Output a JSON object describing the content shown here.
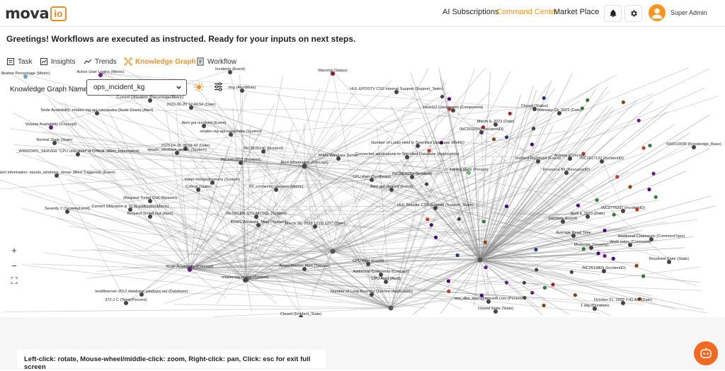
{
  "brand": {
    "logo_main": "mova",
    "logo_sub": "io"
  },
  "topnav": {
    "ai_subscriptions": "AI Subscriptions",
    "command_center": "Command Center",
    "market_place": "Market Place"
  },
  "user": {
    "name": "Super Admin"
  },
  "greeting": "Greetings! Workflows are executed as instructed. Ready for your inputs on next steps.",
  "tabs": [
    {
      "label": "Task",
      "icon": "task-icon"
    },
    {
      "label": "Insights",
      "icon": "insights-icon"
    },
    {
      "label": "Trends",
      "icon": "trends-icon"
    },
    {
      "label": "Knowledge Graph",
      "icon": "graph-icon",
      "active": true
    },
    {
      "label": "Workflow",
      "icon": "workflow-icon"
    }
  ],
  "kg": {
    "label": "Knowledge Graph Name",
    "selected": "ops_incident_kg"
  },
  "zoom": {
    "plus": "+",
    "minus": "−",
    "fit": "⛶"
  },
  "hint": "Left-click: rotate, Mouse-wheel/middle-click: zoom, Right-click: pan, Click: esc for exit full screen",
  "colors": {
    "accent": "#f39321",
    "chatbot": "#f26a21",
    "edge": "#888888"
  },
  "graph_nodes": [
    {
      "label": "ilization Percentage (Metric)",
      "color": "#5da8d8"
    },
    {
      "label": "Active User Logins (Metric)",
      "color": "#6a1b8a"
    },
    {
      "label": "Incidents (Event)",
      "color": "#444"
    },
    {
      "label": "Warning (Status)",
      "color": "#8b1a1a"
    },
    {
      "label": "Current Utilization (Percentage/Metric)",
      "color": "#444"
    },
    {
      "label": "ting (AlertMeta)",
      "color": "#444"
    },
    {
      "label": "HUL-EPOSTV CSS Internal Support (Support_Team)",
      "color": "#444"
    },
    {
      "label": "2023-06-20 12:49:54 (Date)",
      "color": "#444"
    },
    {
      "label": "Node Availability: retailer-stg-api-cassandra (Node Down) (Alert)",
      "color": "#444"
    },
    {
      "label": "Volume Availability (Concept)",
      "color": "#6a1b8a"
    },
    {
      "label": "Alert got resolved (Event)",
      "color": "#444"
    },
    {
      "label": "retailer-stg-api-cassandra (System)",
      "color": "#444"
    },
    {
      "label": "Normal State (State)",
      "color": "#444"
    },
    {
      "label": "2023-04-26 08:58:43 (Date)",
      "color": "#444"
    },
    {
      "label": "_WINDOWS_SERVER \"CPU utilization\" is Critical. (Alert_Information)",
      "color": "#444"
    },
    {
      "label": "epostv_windows_server (System)",
      "color": "#444"
    },
    {
      "label": "Alert Information: epostv_windows_server (Alert Triggered) (Event)",
      "color": "#444"
    },
    {
      "label": "INC3839140 (Incident)",
      "color": "#444"
    },
    {
      "label": "INC6461859 (Incident)",
      "color": "#444"
    },
    {
      "label": "Alert Information (Concept)",
      "color": "#444"
    },
    {
      "label": "RIMS Windows Server",
      "color": "#444"
    },
    {
      "label": "Connected applications to Specified Database (Application)",
      "color": "#444"
    },
    {
      "label": "hilun1/2 Component (Component)",
      "color": "#444"
    },
    {
      "label": "Number of Locks Held in Specified Database (Metric)",
      "color": "#444"
    },
    {
      "label": "ezlan-mongodbpmery (System)",
      "color": "#444"
    },
    {
      "label": "Critical (State)",
      "color": "#444"
    },
    {
      "label": "CPU Alert (Synthesis)",
      "color": "#444"
    },
    {
      "label": "INC2408219 (Incident)",
      "color": "#444"
    },
    {
      "label": "Alert got cleared (Event)",
      "color": "#444"
    },
    {
      "label": "Jubrick Rishi (Person)",
      "color": "#6abf69"
    },
    {
      "label": "(Request Timed Out) (Reason)",
      "color": "#444"
    },
    {
      "label": "IIS_connector_percent (Metric)",
      "color": "#444"
    },
    {
      "label": "HUL Retailer CSS Support (Support_Team)",
      "color": "#444"
    },
    {
      "label": "Current Utilization is 70 % (UtilizationMetric)",
      "color": "#444"
    },
    {
      "label": "Severity 2 (SeverityLevel)",
      "color": "#444"
    },
    {
      "label": "Request Timed Out (Alert)",
      "color": "#444"
    },
    {
      "label": "RETAILER-STG-MYSQL (System)",
      "color": "#444"
    },
    {
      "label": "IRIMS Windows_Main (System)",
      "color": "#444"
    },
    {
      "label": "March 16, 2023 12:09 UTC (Date)",
      "color": "#444"
    },
    {
      "label": "CPU Alert (Event)",
      "color": "#444"
    },
    {
      "label": "Closed (Status)",
      "color": "#444"
    },
    {
      "label": "February 19, 2023 (Date)",
      "color": "#444"
    },
    {
      "label": "INC2612550 (IncidentID)",
      "color": "#444"
    },
    {
      "label": "March 9, 2023 (Date)",
      "color": "#444"
    },
    {
      "label": "Incident Resolved (Event)",
      "color": "#444"
    },
    {
      "label": "Actions (Concept)",
      "color": "#444"
    },
    {
      "label": "INC2617132 (IncidentID)",
      "color": "#444"
    },
    {
      "label": "K60010095 (Knowledge_Base)",
      "color": "#444"
    },
    {
      "label": "Resource ID (ResourceID)",
      "color": "#444"
    },
    {
      "label": "Node Availability (Concept)",
      "color": "#6a1b8a"
    },
    {
      "label": "retailer-stg-mysql (System)",
      "color": "#444"
    },
    {
      "label": "Azure Monitor Alert (Service)",
      "color": "#444"
    },
    {
      "label": "Additional Comments (Concept)",
      "color": "#444"
    },
    {
      "label": "CPU Alert (Alert)",
      "color": "#444"
    },
    {
      "label": "testdbserver-2012.database.windows.net (Database)",
      "color": "#444"
    },
    {
      "label": "Number of Long Running Queries (Application)",
      "color": "#444"
    },
    {
      "label": "rms_dba_team@mresoft.com (Person)",
      "color": "#444"
    },
    {
      "label": "Closed State (State)",
      "color": "#444"
    },
    {
      "label": "Closed (Incident_State)",
      "color": "#444"
    },
    {
      "label": "372.2 C (Temp/Percent)",
      "color": "#444"
    },
    {
      "label": "Resolved State (State)",
      "color": "#444"
    },
    {
      "label": "Work notes (Comment)",
      "color": "#444"
    },
    {
      "label": "INC2612809 (IncidentID)",
      "color": "#444"
    },
    {
      "label": "October 01, 2022 7:41 AM (Date)",
      "color": "#444"
    },
    {
      "label": "1 day (Duration)",
      "color": "#444"
    },
    {
      "label": "patching (Event)",
      "color": "#444"
    },
    {
      "label": "April 4, 2023 (Date)",
      "color": "#444"
    },
    {
      "label": "INC2776297 (IncidentID)",
      "color": "#444"
    },
    {
      "label": "Moderate (Severity)",
      "color": "#444"
    },
    {
      "label": "Additional Comments (CommentType)",
      "color": "#444"
    },
    {
      "label": "Average Read Time",
      "color": "#444"
    }
  ]
}
